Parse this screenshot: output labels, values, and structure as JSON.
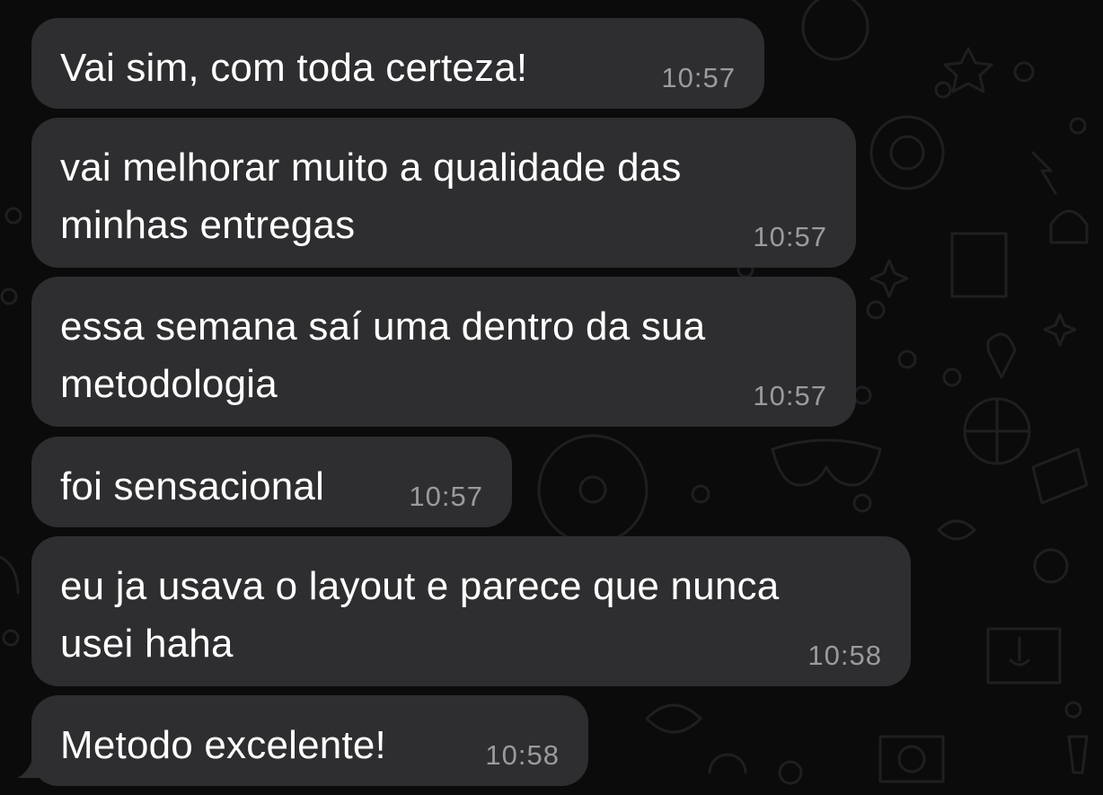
{
  "colors": {
    "background": "#0b0b0c",
    "bubble": "#2e2e30",
    "message_text": "#ffffff",
    "timestamp": "#9a9a9f",
    "wallpaper_doodle": "#1f1f22"
  },
  "messages": [
    {
      "text": "Vai sim, com toda certeza!",
      "time": "10:57"
    },
    {
      "text": "vai melhorar muito a qualidade das\nminhas entregas",
      "time": "10:57"
    },
    {
      "text": "essa semana saí uma dentro da sua\nmetodologia",
      "time": "10:57"
    },
    {
      "text": "foi sensacional",
      "time": "10:57"
    },
    {
      "text": "eu ja usava o layout e parece que nunca\nusei haha",
      "time": "10:58"
    },
    {
      "text": "Metodo excelente!",
      "time": "10:58"
    }
  ]
}
